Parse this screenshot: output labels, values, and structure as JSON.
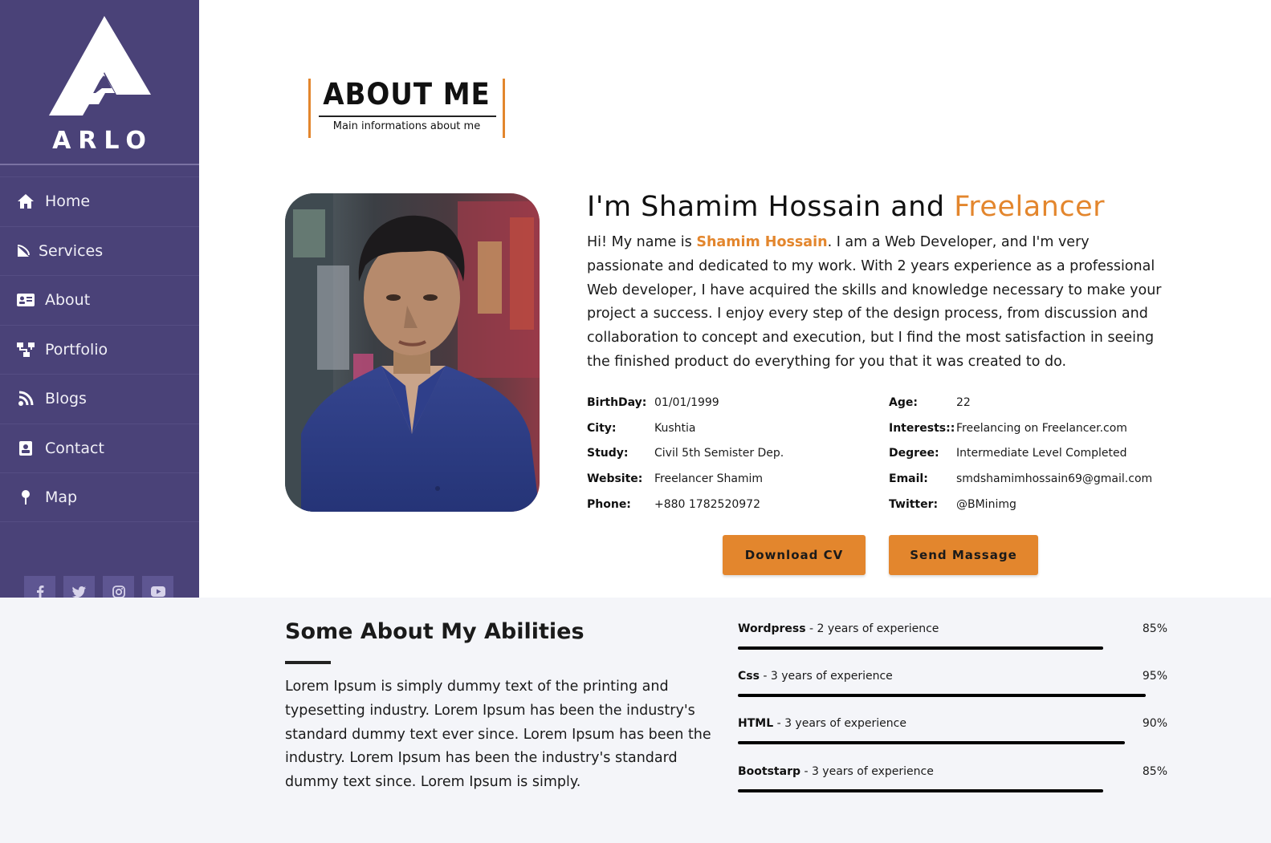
{
  "sidebar": {
    "logo_text": "ARLO",
    "nav": [
      {
        "label": "Home",
        "icon": "home-icon"
      },
      {
        "label": "Services",
        "icon": "services-icon"
      },
      {
        "label": "About",
        "icon": "id-card-icon"
      },
      {
        "label": "Portfolio",
        "icon": "sitemap-icon"
      },
      {
        "label": "Blogs",
        "icon": "rss-icon"
      },
      {
        "label": "Contact",
        "icon": "contact-icon"
      },
      {
        "label": "Map",
        "icon": "map-pin-icon"
      }
    ],
    "social": [
      "facebook-icon",
      "twitter-icon",
      "instagram-icon",
      "youtube-icon"
    ]
  },
  "section": {
    "title": "ABOUT ME",
    "subtitle": "Main informations about me"
  },
  "intro": {
    "heading_prefix": "I'm Shamim Hossain and ",
    "heading_accent": "Freelancer",
    "text_prefix": "Hi! My name is ",
    "text_name": "Shamim Hossain",
    "text_body": ". I am a Web Developer, and I'm very passionate and dedicated to my work. With 2 years experience as a professional Web developer, I have acquired the skills and knowledge necessary to make your project a success. I enjoy every step of the design process, from discussion and collaboration to concept and execution, but I find the most satisfaction in seeing the finished product do everything for you that it was created to do."
  },
  "info": {
    "left": [
      {
        "label": "BirthDay:",
        "value": "01/01/1999"
      },
      {
        "label": "City:",
        "value": "Kushtia"
      },
      {
        "label": "Study:",
        "value": "Civil 5th Semister Dep."
      },
      {
        "label": "Website:",
        "value": "Freelancer Shamim"
      },
      {
        "label": "Phone:",
        "value": "+880 1782520972"
      }
    ],
    "right": [
      {
        "label": "Age:",
        "value": "22"
      },
      {
        "label": "Interests::",
        "value": "Freelancing on Freelancer.com"
      },
      {
        "label": "Degree:",
        "value": "Intermediate Level Completed"
      },
      {
        "label": "Email:",
        "value": "smdshamimhossain69@gmail.com"
      },
      {
        "label": "Twitter:",
        "value": "@BMinimg"
      }
    ]
  },
  "buttons": {
    "download": "Download CV",
    "send": "Send Massage"
  },
  "abilities": {
    "title": "Some About My Abilities",
    "text": "Lorem Ipsum is simply dummy text of the printing and typesetting industry. Lorem Ipsum has been the industry's standard dummy text ever since. Lorem Ipsum has been the industry. Lorem Ipsum has been the industry's standard dummy text since. Lorem Ipsum is simply.",
    "skills": [
      {
        "name": "Wordpress",
        "detail": " - 2 years of experience",
        "percent_label": "85%",
        "percent": 85
      },
      {
        "name": "Css",
        "detail": " - 3 years of experience",
        "percent_label": "95%",
        "percent": 95
      },
      {
        "name": "HTML",
        "detail": " - 3 years of experience",
        "percent_label": "90%",
        "percent": 90
      },
      {
        "name": "Bootstarp",
        "detail": " - 3 years of experience",
        "percent_label": "85%",
        "percent": 85
      }
    ]
  },
  "colors": {
    "sidebar": "#4a4278",
    "accent": "#e3862d"
  }
}
